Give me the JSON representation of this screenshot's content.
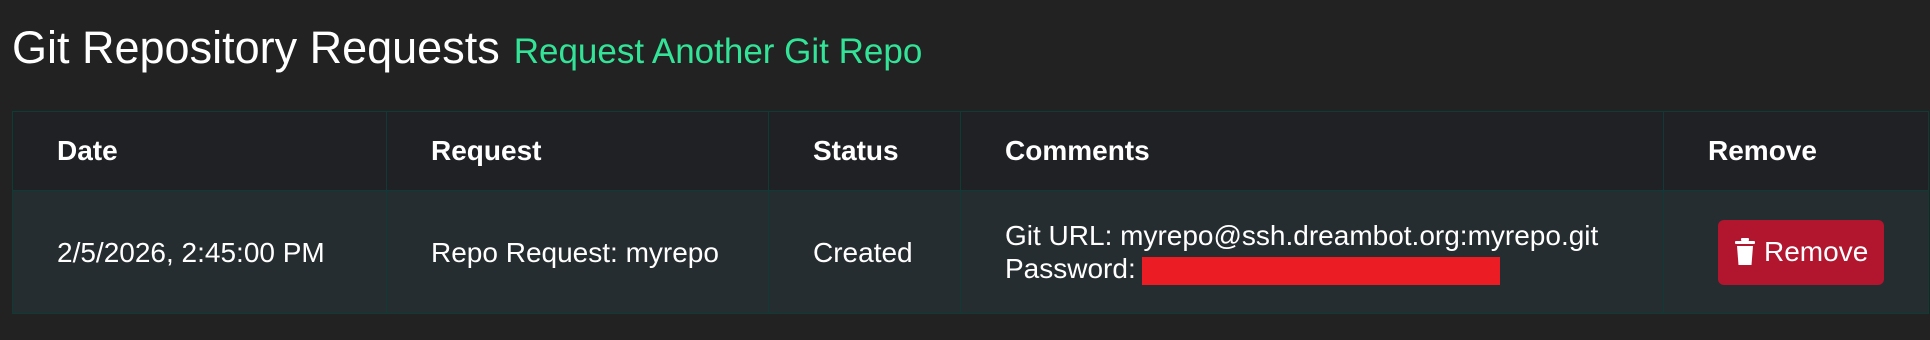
{
  "header": {
    "title": "Git Repository Requests",
    "request_link": "Request Another Git Repo"
  },
  "table": {
    "columns": [
      "Date",
      "Request",
      "Status",
      "Comments",
      "Remove"
    ],
    "rows": [
      {
        "date": "2/5/2026, 2:45:00 PM",
        "request": "Repo Request: myrepo",
        "status": "Created",
        "comment_line1": "Git URL: myrepo@ssh.dreambot.org:myrepo.git",
        "comment_line2_label": "Password:",
        "remove_label": "Remove"
      }
    ]
  },
  "icons": {
    "remove": "trash-icon"
  },
  "colors": {
    "background": "#222222",
    "link": "#33e397",
    "remove_button": "#b2152e",
    "redaction": "#ec1c24"
  }
}
